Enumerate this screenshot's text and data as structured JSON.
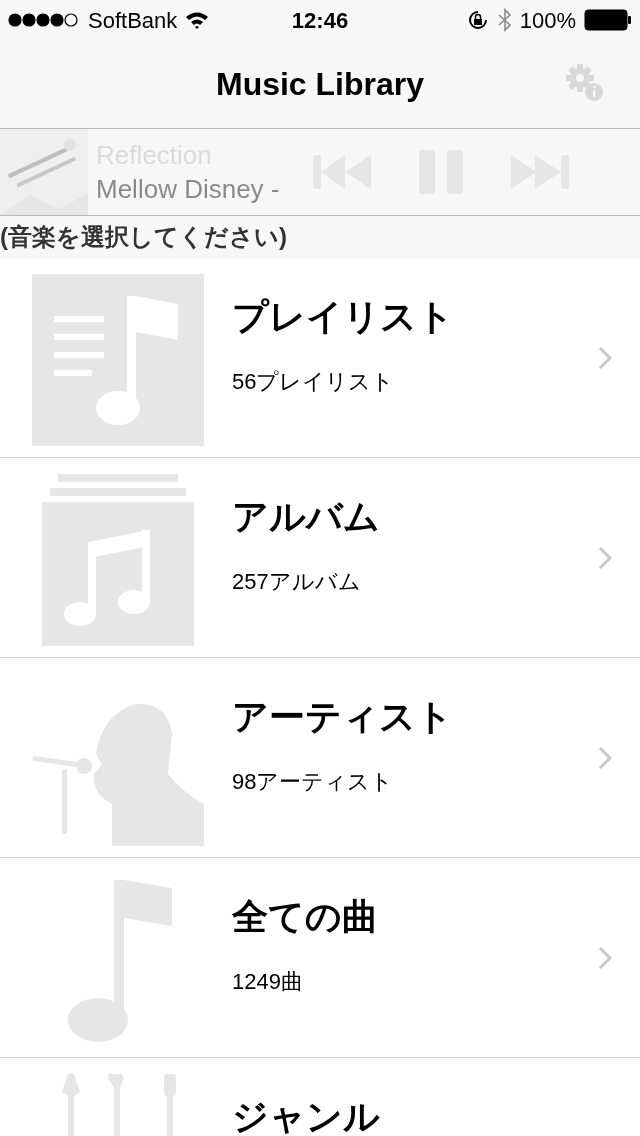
{
  "status_bar": {
    "carrier": "SoftBank",
    "time": "12:46",
    "battery": "100%"
  },
  "nav": {
    "title": "Music Library"
  },
  "player": {
    "track": "Reflection",
    "album": "Mellow Disney -"
  },
  "prompt": "(音楽を選択してください)",
  "categories": [
    {
      "kind": "playlist",
      "title": "プレイリスト",
      "count": "56プレイリスト"
    },
    {
      "kind": "album",
      "title": "アルバム",
      "count": "257アルバム"
    },
    {
      "kind": "artist",
      "title": "アーティスト",
      "count": "98アーティスト"
    },
    {
      "kind": "song",
      "title": "全ての曲",
      "count": "1249曲"
    },
    {
      "kind": "genre",
      "title": "ジャンル"
    }
  ]
}
